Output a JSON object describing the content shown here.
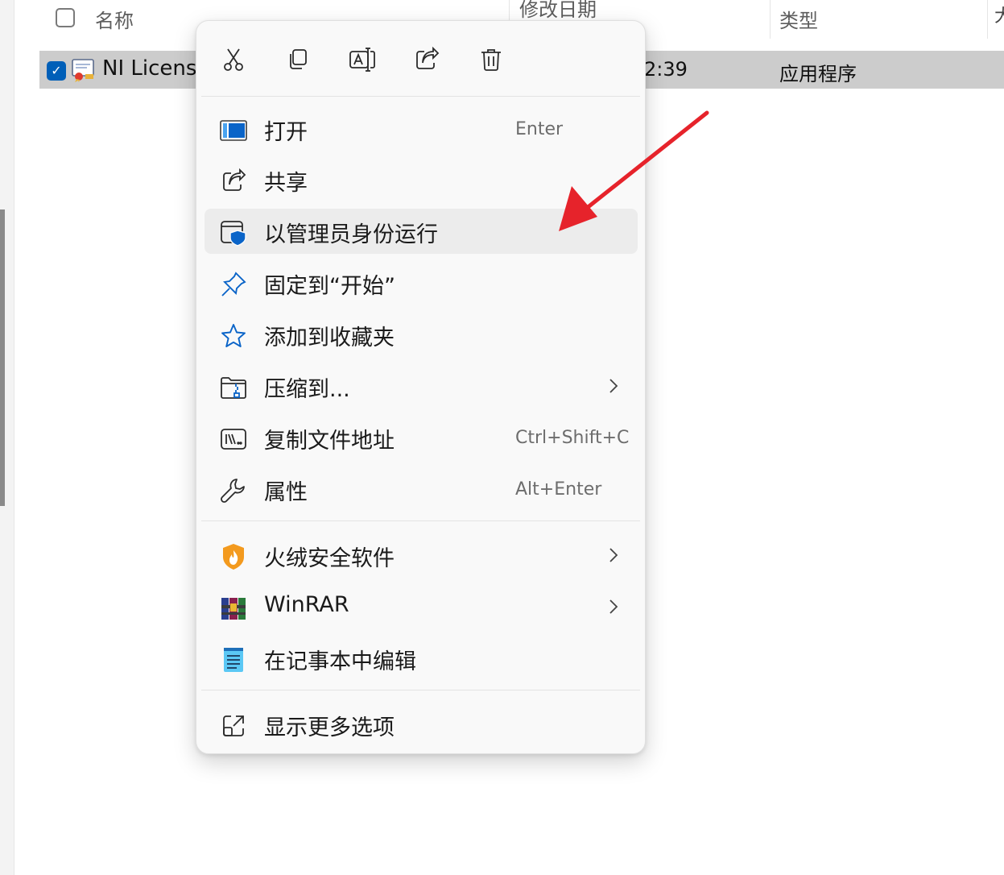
{
  "header": {
    "name_label": "名称",
    "date_label": "修改日期",
    "type_label": "类型"
  },
  "file_row": {
    "name": "NI License",
    "time": "2:39",
    "type": "应用程序"
  },
  "menu": {
    "toolbar": [
      "cut-icon",
      "copy-icon",
      "rename-icon",
      "share-icon",
      "delete-icon"
    ],
    "items": [
      {
        "label": "打开",
        "shortcut": "Enter",
        "icon": "open-app-icon"
      },
      {
        "label": "共享",
        "shortcut": "",
        "icon": "share-icon"
      },
      {
        "label": "以管理员身份运行",
        "shortcut": "",
        "icon": "admin-shield-icon"
      },
      {
        "label": "固定到“开始”",
        "shortcut": "",
        "icon": "pin-icon"
      },
      {
        "label": "添加到收藏夹",
        "shortcut": "",
        "icon": "star-icon"
      },
      {
        "label": "压缩到...",
        "shortcut": "",
        "icon": "zip-folder-icon"
      },
      {
        "label": "复制文件地址",
        "shortcut": "Ctrl+Shift+C",
        "icon": "copy-path-icon"
      },
      {
        "label": "属性",
        "shortcut": "Alt+Enter",
        "icon": "wrench-icon"
      },
      {
        "label": "火绒安全软件",
        "shortcut": "",
        "icon": "huorong-icon"
      },
      {
        "label": "WinRAR",
        "shortcut": "",
        "icon": "winrar-icon"
      },
      {
        "label": "在记事本中编辑",
        "shortcut": "",
        "icon": "notepad-icon"
      },
      {
        "label": "显示更多选项",
        "shortcut": "",
        "icon": "more-options-icon"
      }
    ]
  },
  "colors": {
    "accent": "#005fb8",
    "arrow": "#e6232b",
    "selection": "#cccccc",
    "menu_bg": "#f9f9f9"
  }
}
